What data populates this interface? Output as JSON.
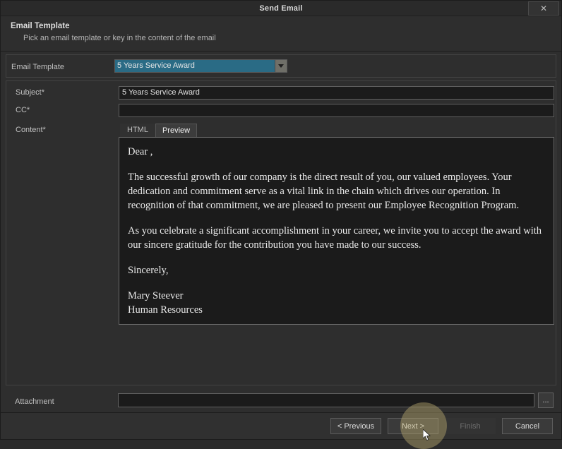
{
  "window": {
    "title": "Send Email",
    "close_label": "✕"
  },
  "header": {
    "title": "Email Template",
    "subtitle": "Pick an email template or key in the content of the email"
  },
  "form": {
    "template": {
      "label": "Email Template",
      "value": "5 Years Service Award",
      "arrow_icon": "chevron-down-icon"
    },
    "subject": {
      "label": "Subject*",
      "value": "5 Years Service Award",
      "placeholder": ""
    },
    "cc": {
      "label": "CC*",
      "value": "",
      "placeholder": ""
    },
    "content": {
      "label": "Content*",
      "tabs": [
        {
          "label": "HTML",
          "active": false
        },
        {
          "label": "Preview",
          "active": true
        }
      ]
    },
    "attachment": {
      "label": "Attachment",
      "value": "",
      "placeholder": "",
      "browse_label": "..."
    }
  },
  "preview": {
    "greeting": "Dear ,",
    "paragraph1": "The successful growth of our company is the direct result of you, our valued employees. Your dedication and commitment serve as a vital link in the chain which drives our operation. In recognition of that commitment, we are pleased to present our Employee Recognition Program.",
    "paragraph2": "As you celebrate a significant accomplishment in your career, we invite you to accept the award with our sincere gratitude for the contribution you have made to our success.",
    "closing": "Sincerely,",
    "signature_name": "Mary Steever",
    "signature_dept": "Human Resources"
  },
  "footer": {
    "buttons": [
      {
        "label": "< Previous",
        "disabled": false
      },
      {
        "label": "Next >",
        "disabled": false
      },
      {
        "label": "Finish",
        "disabled": true
      },
      {
        "label": "Cancel",
        "disabled": false
      }
    ]
  },
  "colors": {
    "accent_select": "#2a6b85",
    "dialog_bg": "#2e2e2e",
    "input_bg": "#1b1b1b",
    "highlight": "#c4b274"
  }
}
